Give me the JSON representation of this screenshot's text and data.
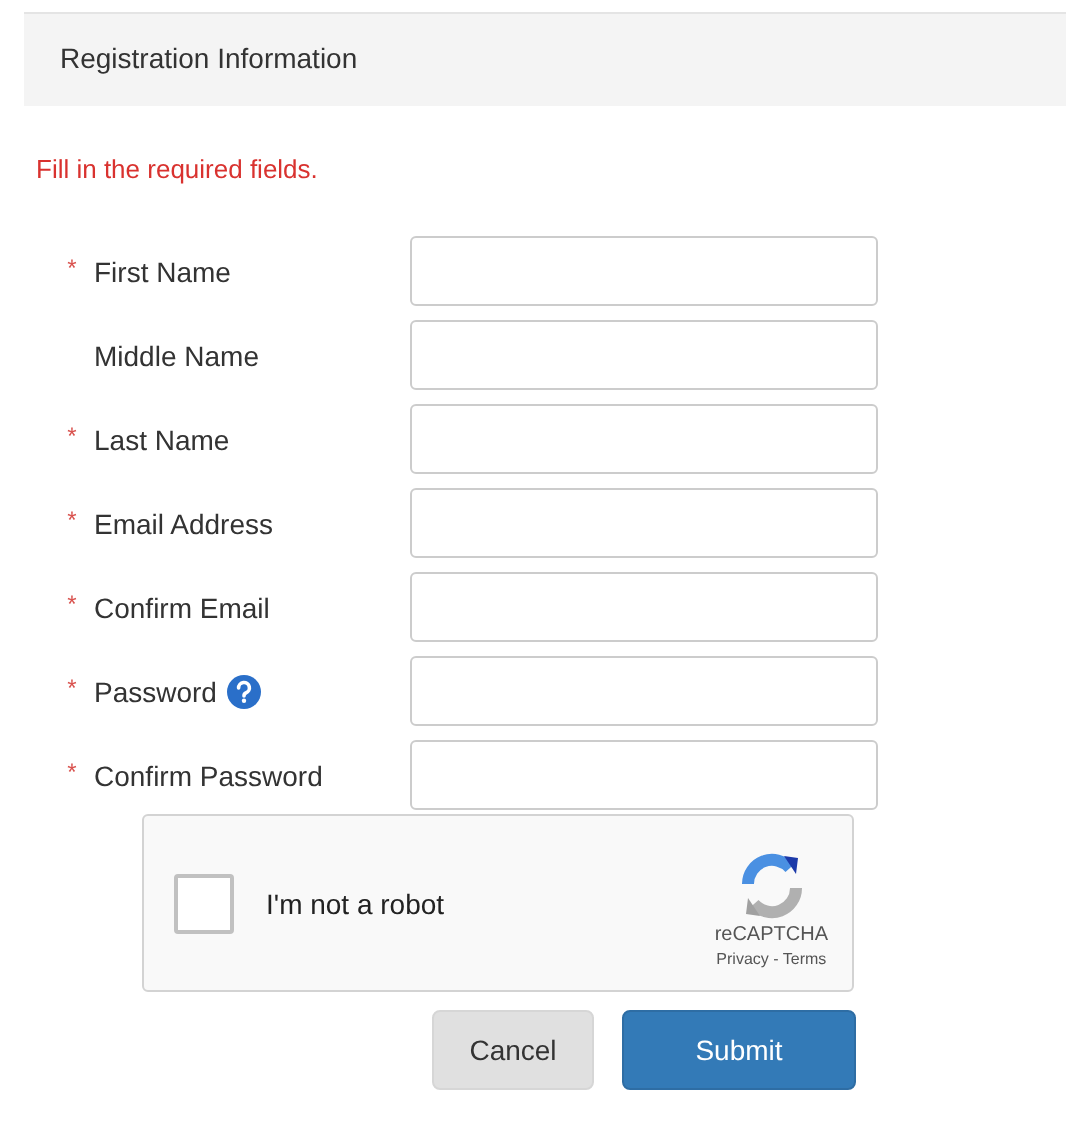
{
  "header": {
    "title": "Registration Information"
  },
  "error": "Fill in the required fields.",
  "fields": [
    {
      "label": "First Name",
      "required": true,
      "help": false
    },
    {
      "label": "Middle Name",
      "required": false,
      "help": false
    },
    {
      "label": "Last Name",
      "required": true,
      "help": false
    },
    {
      "label": "Email Address",
      "required": true,
      "help": false
    },
    {
      "label": "Confirm Email",
      "required": true,
      "help": false
    },
    {
      "label": "Password",
      "required": true,
      "help": true
    },
    {
      "label": "Confirm Password",
      "required": true,
      "help": false
    }
  ],
  "required_mark": "*",
  "captcha": {
    "label": "I'm not a robot",
    "checked": false,
    "brand": "reCAPTCHA",
    "links": "Privacy - Terms"
  },
  "buttons": [
    {
      "label": "Cancel",
      "kind": "secondary"
    },
    {
      "label": "Submit",
      "kind": "primary"
    }
  ]
}
